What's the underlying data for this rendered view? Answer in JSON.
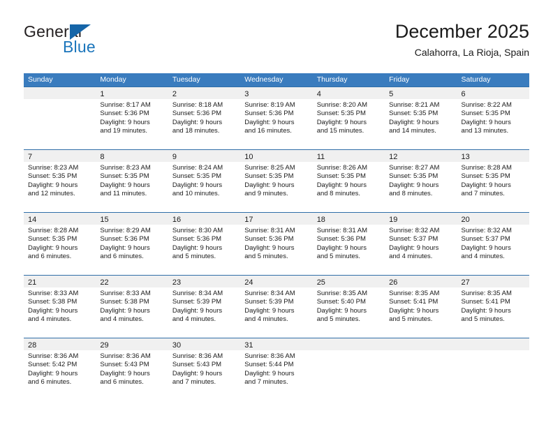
{
  "brand": {
    "name_part1": "General",
    "name_part2": "Blue",
    "logo_icon": "triangle-icon"
  },
  "header": {
    "title": "December 2025",
    "subtitle": "Calahorra, La Rioja, Spain"
  },
  "colors": {
    "header_blue": "#3a7cbe",
    "row_divider_blue": "#2f6ea8",
    "daynum_band": "#f0f0f0",
    "brand_blue": "#1b75bb",
    "text": "#1a1a1a"
  },
  "weekdays": [
    "Sunday",
    "Monday",
    "Tuesday",
    "Wednesday",
    "Thursday",
    "Friday",
    "Saturday"
  ],
  "weeks": [
    [
      {
        "day": "",
        "sunrise": "",
        "sunset": "",
        "daylight_l1": "",
        "daylight_l2": "",
        "empty": true
      },
      {
        "day": "1",
        "sunrise": "Sunrise: 8:17 AM",
        "sunset": "Sunset: 5:36 PM",
        "daylight_l1": "Daylight: 9 hours",
        "daylight_l2": "and 19 minutes."
      },
      {
        "day": "2",
        "sunrise": "Sunrise: 8:18 AM",
        "sunset": "Sunset: 5:36 PM",
        "daylight_l1": "Daylight: 9 hours",
        "daylight_l2": "and 18 minutes."
      },
      {
        "day": "3",
        "sunrise": "Sunrise: 8:19 AM",
        "sunset": "Sunset: 5:36 PM",
        "daylight_l1": "Daylight: 9 hours",
        "daylight_l2": "and 16 minutes."
      },
      {
        "day": "4",
        "sunrise": "Sunrise: 8:20 AM",
        "sunset": "Sunset: 5:35 PM",
        "daylight_l1": "Daylight: 9 hours",
        "daylight_l2": "and 15 minutes."
      },
      {
        "day": "5",
        "sunrise": "Sunrise: 8:21 AM",
        "sunset": "Sunset: 5:35 PM",
        "daylight_l1": "Daylight: 9 hours",
        "daylight_l2": "and 14 minutes."
      },
      {
        "day": "6",
        "sunrise": "Sunrise: 8:22 AM",
        "sunset": "Sunset: 5:35 PM",
        "daylight_l1": "Daylight: 9 hours",
        "daylight_l2": "and 13 minutes."
      }
    ],
    [
      {
        "day": "7",
        "sunrise": "Sunrise: 8:23 AM",
        "sunset": "Sunset: 5:35 PM",
        "daylight_l1": "Daylight: 9 hours",
        "daylight_l2": "and 12 minutes."
      },
      {
        "day": "8",
        "sunrise": "Sunrise: 8:23 AM",
        "sunset": "Sunset: 5:35 PM",
        "daylight_l1": "Daylight: 9 hours",
        "daylight_l2": "and 11 minutes."
      },
      {
        "day": "9",
        "sunrise": "Sunrise: 8:24 AM",
        "sunset": "Sunset: 5:35 PM",
        "daylight_l1": "Daylight: 9 hours",
        "daylight_l2": "and 10 minutes."
      },
      {
        "day": "10",
        "sunrise": "Sunrise: 8:25 AM",
        "sunset": "Sunset: 5:35 PM",
        "daylight_l1": "Daylight: 9 hours",
        "daylight_l2": "and 9 minutes."
      },
      {
        "day": "11",
        "sunrise": "Sunrise: 8:26 AM",
        "sunset": "Sunset: 5:35 PM",
        "daylight_l1": "Daylight: 9 hours",
        "daylight_l2": "and 8 minutes."
      },
      {
        "day": "12",
        "sunrise": "Sunrise: 8:27 AM",
        "sunset": "Sunset: 5:35 PM",
        "daylight_l1": "Daylight: 9 hours",
        "daylight_l2": "and 8 minutes."
      },
      {
        "day": "13",
        "sunrise": "Sunrise: 8:28 AM",
        "sunset": "Sunset: 5:35 PM",
        "daylight_l1": "Daylight: 9 hours",
        "daylight_l2": "and 7 minutes."
      }
    ],
    [
      {
        "day": "14",
        "sunrise": "Sunrise: 8:28 AM",
        "sunset": "Sunset: 5:35 PM",
        "daylight_l1": "Daylight: 9 hours",
        "daylight_l2": "and 6 minutes."
      },
      {
        "day": "15",
        "sunrise": "Sunrise: 8:29 AM",
        "sunset": "Sunset: 5:36 PM",
        "daylight_l1": "Daylight: 9 hours",
        "daylight_l2": "and 6 minutes."
      },
      {
        "day": "16",
        "sunrise": "Sunrise: 8:30 AM",
        "sunset": "Sunset: 5:36 PM",
        "daylight_l1": "Daylight: 9 hours",
        "daylight_l2": "and 5 minutes."
      },
      {
        "day": "17",
        "sunrise": "Sunrise: 8:31 AM",
        "sunset": "Sunset: 5:36 PM",
        "daylight_l1": "Daylight: 9 hours",
        "daylight_l2": "and 5 minutes."
      },
      {
        "day": "18",
        "sunrise": "Sunrise: 8:31 AM",
        "sunset": "Sunset: 5:36 PM",
        "daylight_l1": "Daylight: 9 hours",
        "daylight_l2": "and 5 minutes."
      },
      {
        "day": "19",
        "sunrise": "Sunrise: 8:32 AM",
        "sunset": "Sunset: 5:37 PM",
        "daylight_l1": "Daylight: 9 hours",
        "daylight_l2": "and 4 minutes."
      },
      {
        "day": "20",
        "sunrise": "Sunrise: 8:32 AM",
        "sunset": "Sunset: 5:37 PM",
        "daylight_l1": "Daylight: 9 hours",
        "daylight_l2": "and 4 minutes."
      }
    ],
    [
      {
        "day": "21",
        "sunrise": "Sunrise: 8:33 AM",
        "sunset": "Sunset: 5:38 PM",
        "daylight_l1": "Daylight: 9 hours",
        "daylight_l2": "and 4 minutes."
      },
      {
        "day": "22",
        "sunrise": "Sunrise: 8:33 AM",
        "sunset": "Sunset: 5:38 PM",
        "daylight_l1": "Daylight: 9 hours",
        "daylight_l2": "and 4 minutes."
      },
      {
        "day": "23",
        "sunrise": "Sunrise: 8:34 AM",
        "sunset": "Sunset: 5:39 PM",
        "daylight_l1": "Daylight: 9 hours",
        "daylight_l2": "and 4 minutes."
      },
      {
        "day": "24",
        "sunrise": "Sunrise: 8:34 AM",
        "sunset": "Sunset: 5:39 PM",
        "daylight_l1": "Daylight: 9 hours",
        "daylight_l2": "and 4 minutes."
      },
      {
        "day": "25",
        "sunrise": "Sunrise: 8:35 AM",
        "sunset": "Sunset: 5:40 PM",
        "daylight_l1": "Daylight: 9 hours",
        "daylight_l2": "and 5 minutes."
      },
      {
        "day": "26",
        "sunrise": "Sunrise: 8:35 AM",
        "sunset": "Sunset: 5:41 PM",
        "daylight_l1": "Daylight: 9 hours",
        "daylight_l2": "and 5 minutes."
      },
      {
        "day": "27",
        "sunrise": "Sunrise: 8:35 AM",
        "sunset": "Sunset: 5:41 PM",
        "daylight_l1": "Daylight: 9 hours",
        "daylight_l2": "and 5 minutes."
      }
    ],
    [
      {
        "day": "28",
        "sunrise": "Sunrise: 8:36 AM",
        "sunset": "Sunset: 5:42 PM",
        "daylight_l1": "Daylight: 9 hours",
        "daylight_l2": "and 6 minutes."
      },
      {
        "day": "29",
        "sunrise": "Sunrise: 8:36 AM",
        "sunset": "Sunset: 5:43 PM",
        "daylight_l1": "Daylight: 9 hours",
        "daylight_l2": "and 6 minutes."
      },
      {
        "day": "30",
        "sunrise": "Sunrise: 8:36 AM",
        "sunset": "Sunset: 5:43 PM",
        "daylight_l1": "Daylight: 9 hours",
        "daylight_l2": "and 7 minutes."
      },
      {
        "day": "31",
        "sunrise": "Sunrise: 8:36 AM",
        "sunset": "Sunset: 5:44 PM",
        "daylight_l1": "Daylight: 9 hours",
        "daylight_l2": "and 7 minutes."
      },
      {
        "day": "",
        "sunrise": "",
        "sunset": "",
        "daylight_l1": "",
        "daylight_l2": "",
        "empty": true
      },
      {
        "day": "",
        "sunrise": "",
        "sunset": "",
        "daylight_l1": "",
        "daylight_l2": "",
        "empty": true
      },
      {
        "day": "",
        "sunrise": "",
        "sunset": "",
        "daylight_l1": "",
        "daylight_l2": "",
        "empty": true
      }
    ]
  ]
}
